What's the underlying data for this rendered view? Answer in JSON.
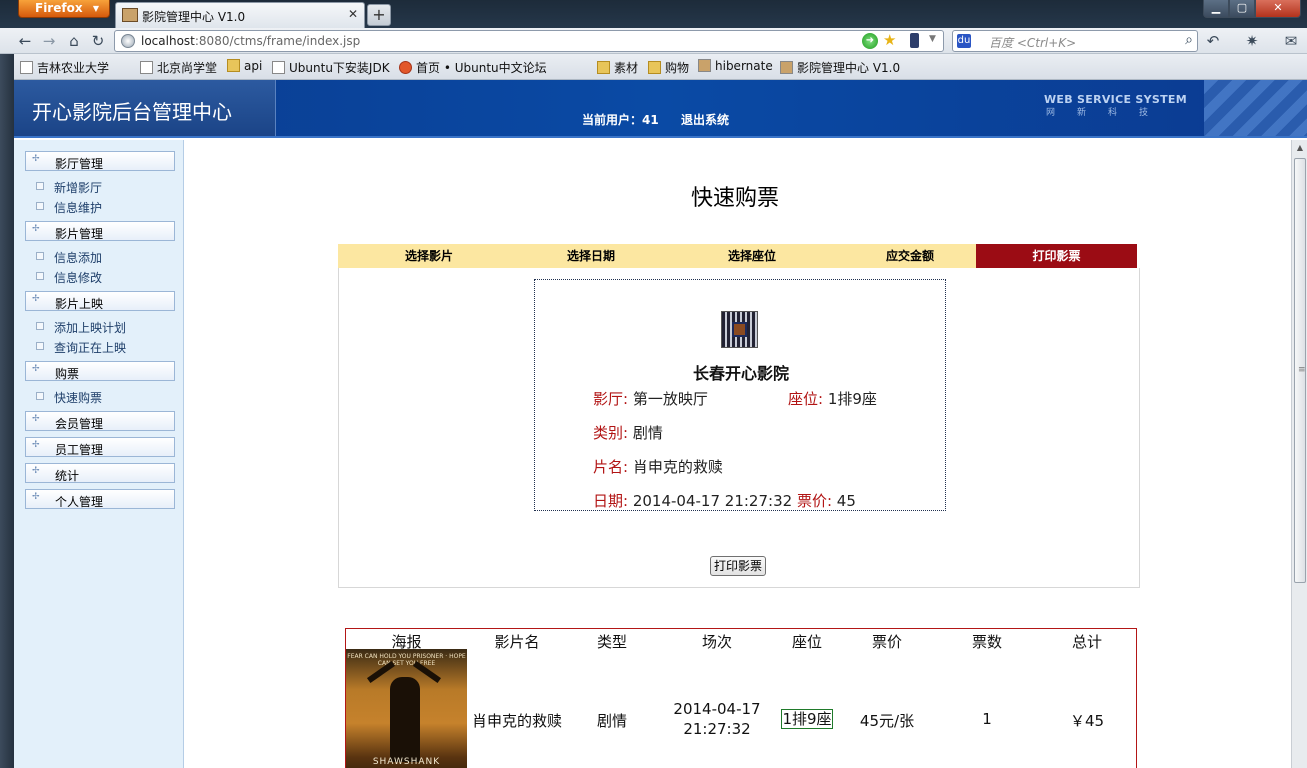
{
  "browser": {
    "menu_label": "Firefox",
    "tab_title": "影院管理中心 V1.0",
    "url_host": "localhost",
    "url_rest": ":8080/ctms/frame/index.jsp",
    "search_placeholder": "百度 <Ctrl+K>",
    "bookmarks": [
      "吉林农业大学",
      "北京尚学堂",
      "api",
      "Ubuntu下安装JDK",
      "首页 • Ubuntu中文论坛",
      "素材",
      "购物",
      "hibernate",
      "影院管理中心 V1.0"
    ]
  },
  "header": {
    "logo": "开心影院后台管理中心",
    "current_user_label": "当前用户：41",
    "logout": "退出系统",
    "brand_title": "WEB SERVICE SYSTEM",
    "brand_sub": "网新科技"
  },
  "sidebar": {
    "sections": [
      {
        "label": "影厅管理",
        "items": [
          "新增影厅",
          "信息维护"
        ]
      },
      {
        "label": "影片管理",
        "items": [
          "信息添加",
          "信息修改"
        ]
      },
      {
        "label": "影片上映",
        "items": [
          "添加上映计划",
          "查询正在上映"
        ]
      },
      {
        "label": "购票",
        "items": [
          "快速购票"
        ]
      },
      {
        "label": "会员管理",
        "items": []
      },
      {
        "label": "员工管理",
        "items": []
      },
      {
        "label": "统计",
        "items": []
      },
      {
        "label": "个人管理",
        "items": []
      }
    ]
  },
  "main": {
    "title": "快速购票",
    "steps": [
      "选择影片",
      "选择日期",
      "选择座位",
      "应交金额",
      "打印影票"
    ],
    "active_step": 4,
    "ticket": {
      "cinema": "长春开心影院",
      "hall_label": "影厅:",
      "hall": "第一放映厅",
      "seat_label": "座位:",
      "seat": "1排9座",
      "type_label": "类别:",
      "type": "剧情",
      "film_label": "片名:",
      "film": "肖申克的救赎",
      "date_label": "日期:",
      "date": "2014-04-17 21:27:32",
      "price_label": "票价:",
      "price": "45"
    },
    "print_button": "打印影票",
    "order_table": {
      "headers": [
        "海报",
        "影片名",
        "类型",
        "场次",
        "座位",
        "票价",
        "票数",
        "总计"
      ],
      "row": {
        "poster_tagline": "FEAR CAN HOLD YOU PRISONER · HOPE CAN SET YOU FREE",
        "poster_title": "SHAWSHANK",
        "film": "肖申克的救赎",
        "type": "剧情",
        "date": "2014-04-17",
        "time": "21:27:32",
        "seat": "1排9座",
        "price": "45元/张",
        "count": "1",
        "total": "￥45"
      }
    }
  },
  "colors": {
    "header_blue": "#0a4aa5",
    "step_bar": "#fce7a1",
    "step_active": "#9b0c14",
    "ticket_label": "#b21414",
    "sidebar_bg": "#e3f0fa"
  }
}
